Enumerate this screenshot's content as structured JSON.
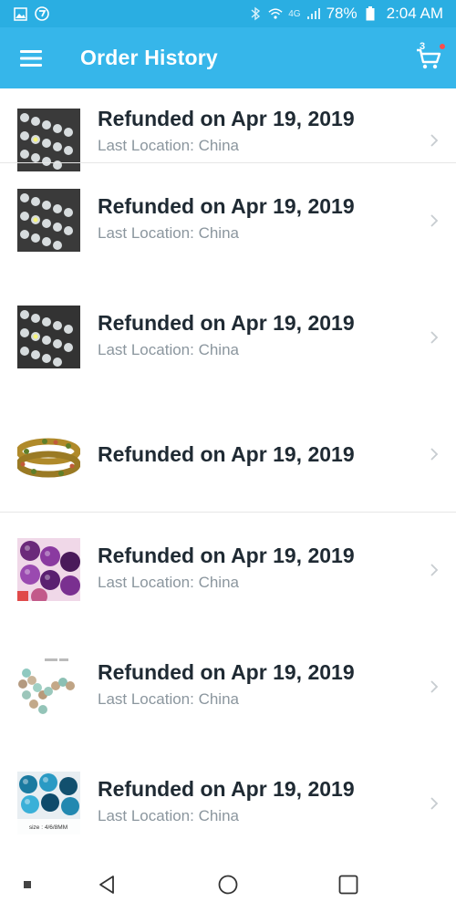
{
  "status_bar": {
    "battery": "78%",
    "time": "2:04 AM",
    "network": "4G"
  },
  "app_bar": {
    "title": "Order History",
    "cart_count": "3"
  },
  "orders": [
    {
      "title": "Refunded on Apr 19, 2019",
      "subtitle": "Last Location: China",
      "thumb": "crystal-beads"
    },
    {
      "title": "Refunded on Apr 19, 2019",
      "subtitle": "Last Location: China",
      "thumb": "crystal-beads"
    },
    {
      "title": "Refunded on Apr 19, 2019",
      "subtitle": "Last Location: China",
      "thumb": "crystal-beads"
    },
    {
      "title": "Refunded on Apr 19, 2019",
      "subtitle": "",
      "thumb": "tourmaline-bracelet"
    },
    {
      "title": "Refunded on Apr 19, 2019",
      "subtitle": "Last Location: China",
      "thumb": "purple-agate-beads"
    },
    {
      "title": "Refunded on Apr 19, 2019",
      "subtitle": "Last Location: China",
      "thumb": "jasper-beads-strand"
    },
    {
      "title": "Refunded on Apr 19, 2019",
      "subtitle": "Last Location: China",
      "thumb": "blue-agate-beads",
      "thumb_caption": "size : 4/6/8MM"
    }
  ],
  "colors": {
    "status_bar": "#2aaee2",
    "app_bar": "#36b6ea",
    "title_text": "#1f2a33",
    "subtitle_text": "#8b969e"
  }
}
